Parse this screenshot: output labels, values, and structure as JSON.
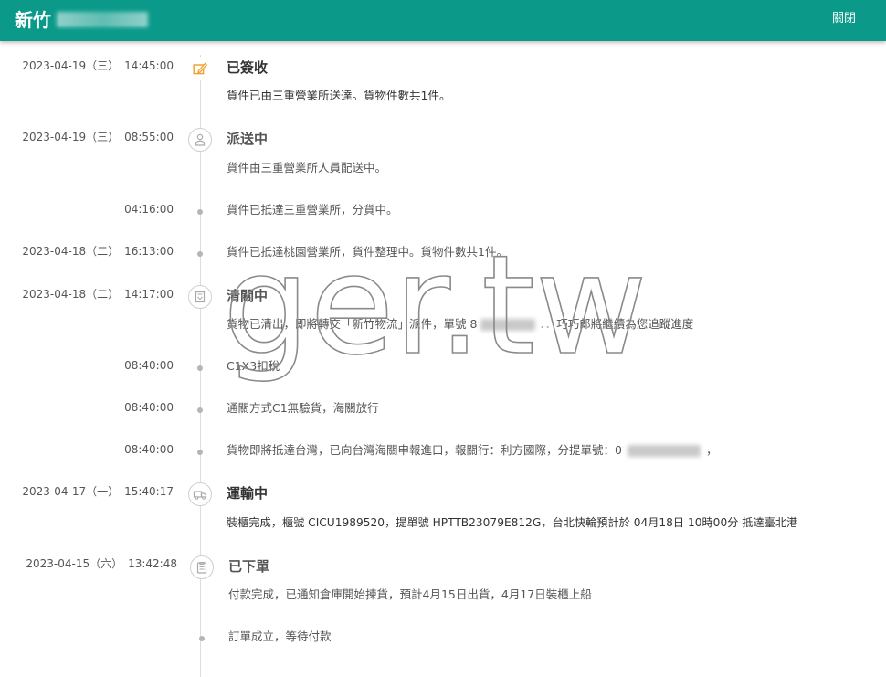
{
  "header": {
    "title": "新竹",
    "close_label": "關閉",
    "bg_color": "#0b9a8a"
  },
  "watermark": "ger.tw",
  "events": [
    {
      "date": "2023-04-19（三）",
      "time": "14:45:00",
      "icon": "edit-signature-icon",
      "status": "已簽收",
      "desc": "貨件已由三重營業所送達。貨物件數共1件。"
    },
    {
      "date": "2023-04-19（三）",
      "time": "08:55:00",
      "icon": "delivery-person-icon",
      "status": "派送中",
      "desc": "貨件由三重營業所人員配送中。"
    },
    {
      "date": "",
      "time": "04:16:00",
      "icon": "dot",
      "status": "",
      "desc": "貨件已抵達三重營業所，分貨中。"
    },
    {
      "date": "2023-04-18（二）",
      "time": "16:13:00",
      "icon": "dot",
      "status": "",
      "desc": "貨件已抵達桃園營業所，貨件整理中。貨物件數共1件。"
    },
    {
      "date": "2023-04-18（二）",
      "time": "14:17:00",
      "icon": "customs-document-icon",
      "status": "清關中",
      "desc_pre": "貨物已清出，即將轉交「新竹物流」派件，單號 8",
      "desc_post": "巧巧郎將繼續為您追蹤進度"
    },
    {
      "date": "",
      "time": "08:40:00",
      "icon": "dot",
      "status": "",
      "desc": "C1X3扣稅"
    },
    {
      "date": "",
      "time": "08:40:00",
      "icon": "dot",
      "status": "",
      "desc": "通關方式C1無驗貨，海關放行"
    },
    {
      "date": "",
      "time": "08:40:00",
      "icon": "dot",
      "status": "",
      "desc_pre": "貨物即將抵達台灣，已向台灣海關申報進口，報關行：利方國際，分提單號：0",
      "desc_post": "，"
    },
    {
      "date": "2023-04-17（一）",
      "time": "15:40:17",
      "icon": "truck-icon",
      "status": "運輸中",
      "desc": "裝櫃完成，櫃號 CICU1989520，提單號 HPTTB23079E812G，台北快輪預計於 04月18日 10時00分 抵達臺北港"
    },
    {
      "date": "2023-04-15（六）",
      "time": "13:42:48",
      "icon": "clipboard-icon",
      "status": "已下單",
      "desc": "付款完成，已通知倉庫開始揀貨，預計4月15日出貨，4月17日裝櫃上船"
    },
    {
      "date": "",
      "time": "",
      "icon": "dot",
      "status": "",
      "desc": "訂單成立，等待付款"
    }
  ]
}
